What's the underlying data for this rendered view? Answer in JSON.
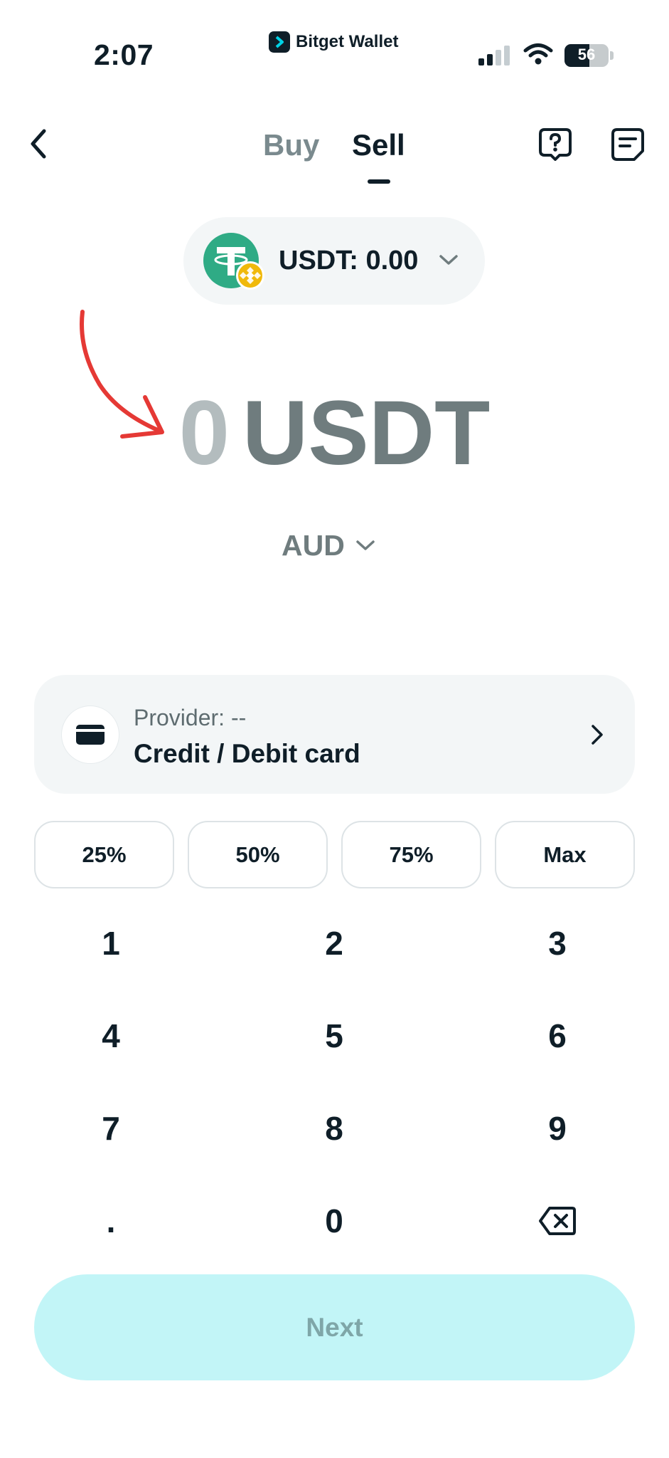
{
  "status_bar": {
    "time": "2:07",
    "app_badge": "Bitget Wallet",
    "battery": "56",
    "battery_level_percent": 56
  },
  "header": {
    "tabs": [
      {
        "label": "Buy",
        "active": false
      },
      {
        "label": "Sell",
        "active": true
      }
    ],
    "icons": {
      "back": "chevron-left-icon",
      "help": "help-question-icon",
      "orders": "order-list-icon"
    }
  },
  "token_selector": {
    "balance_label": "USDT: 0.00",
    "token_icon": "tether-usdt-icon",
    "chain_icon": "bnb-chain-icon"
  },
  "amount": {
    "value": "0",
    "unit": "USDT"
  },
  "currency": {
    "code": "AUD"
  },
  "provider": {
    "caption": "Provider: --",
    "method": "Credit / Debit card",
    "icon": "wallet-card-icon"
  },
  "percent_buttons": [
    "25%",
    "50%",
    "75%",
    "Max"
  ],
  "keypad": {
    "keys": [
      "1",
      "2",
      "3",
      "4",
      "5",
      "6",
      "7",
      "8",
      "9",
      ".",
      "0"
    ],
    "backspace_icon": "backspace-icon"
  },
  "next_button": {
    "label": "Next",
    "enabled": false
  },
  "colors": {
    "accent_disabled": "#c2f5f7",
    "text_primary": "#0f1e28",
    "text_muted": "#6f7c7e",
    "surface": "#f3f6f7",
    "annotation_red": "#e53935",
    "tether_green": "#2fab85",
    "bnb_yellow": "#f0b90b"
  }
}
